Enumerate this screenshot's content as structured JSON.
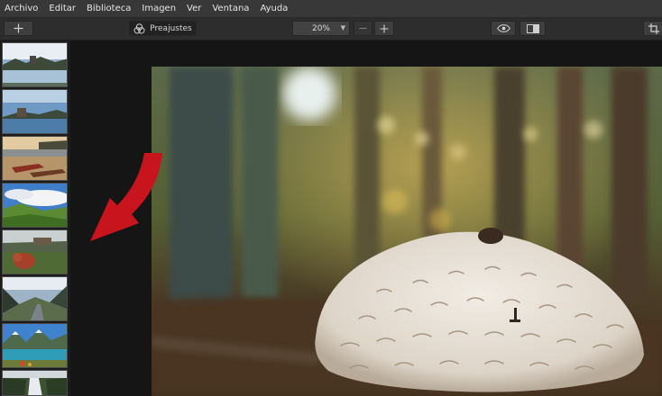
{
  "menubar": {
    "items": [
      {
        "label": "Archivo"
      },
      {
        "label": "Editar"
      },
      {
        "label": "Biblioteca"
      },
      {
        "label": "Imagen"
      },
      {
        "label": "Ver"
      },
      {
        "label": "Ventana"
      },
      {
        "label": "Ayuda"
      }
    ]
  },
  "toolbar": {
    "add_icon": "plus-icon",
    "presets_label": "Preajustes",
    "zoom_value": "20%",
    "zoom_minus_icon": "minus-icon",
    "zoom_plus_icon": "plus-icon",
    "preview_icon": "eye-icon",
    "compare_icon": "compare-icon",
    "crop_icon": "crop-icon"
  },
  "filmstrip": {
    "thumbnails": [
      {
        "subject": "lake castle"
      },
      {
        "subject": "castle on lake"
      },
      {
        "subject": "boats on beach at sunset"
      },
      {
        "subject": "green hills under blue sky"
      },
      {
        "subject": "highland cow"
      },
      {
        "subject": "mountain valley road"
      },
      {
        "subject": "mountain lake"
      },
      {
        "subject": "waterfall"
      }
    ]
  },
  "colors": {
    "accent_arrow": "#c8141c",
    "menubar_bg": "#383838",
    "toolbar_bg": "#2d2d2d"
  }
}
